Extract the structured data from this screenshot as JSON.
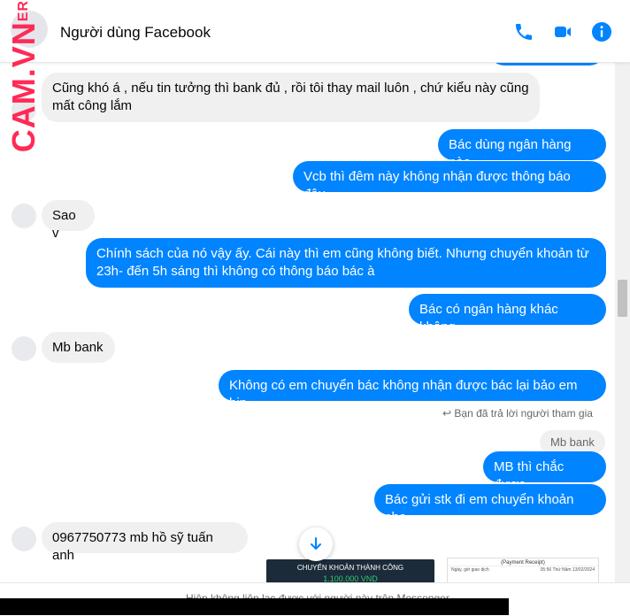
{
  "watermark": {
    "small": "ER",
    "main": "CAM.VN"
  },
  "header": {
    "title": "Người dùng Facebook",
    "icons": [
      "phone-icon",
      "video-icon",
      "info-icon"
    ],
    "accent": "#0084ff"
  },
  "messages": [
    {
      "side": "in",
      "text": "Cũng khó á , nếu tin tưởng thì bank đủ , rồi tôi thay mail luôn , chứ kiểu này cũng mất công lắm"
    },
    {
      "side": "out",
      "text": "Bác dùng ngân hàng nào"
    },
    {
      "side": "out",
      "text": "Vcb thì đêm này không nhận được thông báo đâu"
    },
    {
      "side": "in",
      "text": "Sao v"
    },
    {
      "side": "out",
      "text": "Chính sách của nó vậy ấy. Cái này thì em cũng không biết. Nhưng chuyển khoản từ 23h- đến 5h sáng thì không có thông báo bác à"
    },
    {
      "side": "out",
      "text": "Bác có ngân hàng khác không"
    },
    {
      "side": "in",
      "text": "Mb bank"
    },
    {
      "side": "out",
      "text": "Không có em chuyển bác không nhận được bác lại bảo em bịp"
    },
    {
      "side": "out",
      "text": "MB thì chắc được"
    },
    {
      "side": "out",
      "text": "Bác gửi stk đi em chuyển khoản cho"
    },
    {
      "side": "in",
      "text": "0967750773 mb hồ sỹ tuấn anh"
    }
  ],
  "reply": {
    "note": "Bạn đã trả lời người tham gia",
    "quoted": "Mb bank"
  },
  "receipts": {
    "first_title": "CHUYỂN KHOẢN THÀNH CÔNG",
    "first_amount": "1.100.000 VND",
    "second_title": "(Payment Receipt)",
    "second_row1_label": "Ngày, giờ giao dịch",
    "second_row1_value": "05:56 Thứ Năm 13/02/2024"
  },
  "footer": {
    "text": "Hiện không liên lạc được với người này trên Messenger"
  },
  "colors": {
    "incoming_bubble": "#f0f0f0",
    "outgoing_bubble": "#0084ff",
    "watermark": "#ff2a55"
  }
}
